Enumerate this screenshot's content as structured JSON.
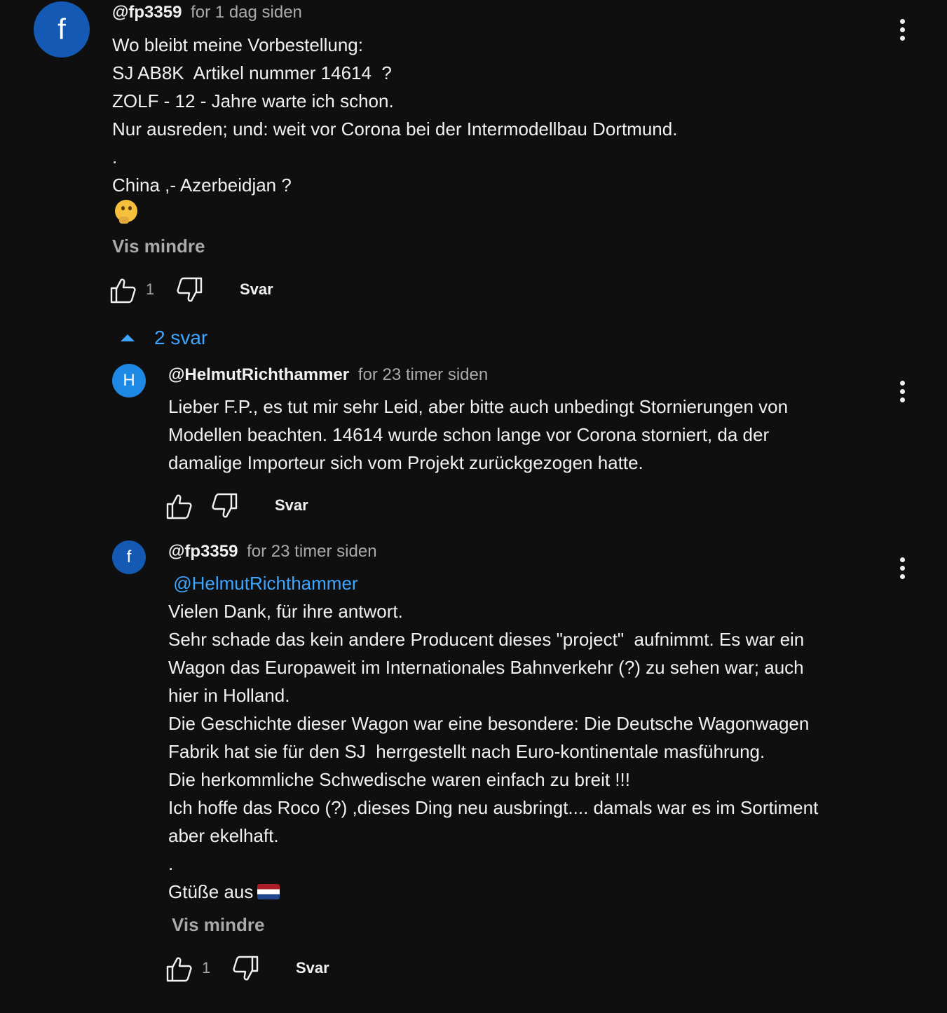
{
  "top_comment": {
    "avatar_letter": "f",
    "handle": "@fp3359",
    "time": "for 1 dag siden",
    "lines": [
      "Wo bleibt meine Vorbestellung:",
      "SJ AB8K  Artikel nummer 14614  ?",
      "ZOLF - 12 - Jahre warte ich schon.",
      "Nur ausreden; und: weit vor Corona bei der Intermodellbau Dortmund.",
      ".",
      "China ,- Azerbeidjan ?"
    ],
    "emoji": "thinking-face",
    "show_less": "Vis mindre",
    "like_count": "1",
    "reply_label": "Svar"
  },
  "replies_toggle": {
    "label": "2 svar"
  },
  "reply_1": {
    "avatar_letter": "H",
    "handle": "@HelmutRichthammer",
    "time": "for 23 timer siden",
    "lines": [
      "Lieber F.P., es tut mir sehr Leid, aber bitte auch unbedingt Stornierungen von",
      "Modellen beachten. 14614 wurde schon lange vor Corona storniert, da der",
      "damalige Importeur sich vom Projekt zurückgezogen hatte."
    ],
    "reply_label": "Svar"
  },
  "reply_2": {
    "avatar_letter": "f",
    "handle": "@fp3359",
    "time": "for 23 timer siden",
    "mention": "@HelmutRichthammer",
    "lines": [
      "Vielen Dank, für ihre antwort.",
      "Sehr schade das kein andere Producent dieses \"project\"  aufnimmt. Es war ein",
      "Wagon das Europaweit im Internationales Bahnverkehr (?) zu sehen war; auch",
      "hier in Holland.",
      "Die Geschichte dieser Wagon war eine besondere: Die Deutsche Wagonwagen",
      "Fabrik hat sie für den SJ  herrgestellt nach Euro-kontinentale masführung.",
      "Die herkommliche Schwedische waren einfach zu breit !!!",
      "Ich hoffe das Roco (?) ,dieses Ding neu ausbringt.... damals war es im Sortiment",
      "aber ekelhaft.",
      "."
    ],
    "greeting": "Gtüße aus",
    "flag": "netherlands-flag",
    "show_less": "Vis mindre",
    "like_count": "1",
    "reply_label": "Svar"
  },
  "icons": {
    "like": "thumbs-up-icon",
    "dislike": "thumbs-down-icon",
    "more": "more-vert-icon",
    "collapse": "caret-up-icon"
  },
  "colors": {
    "background": "#0f0f0f",
    "text": "#f1f1f1",
    "secondary": "#aaaaaa",
    "link": "#3ea6ff",
    "avatar": "#1565c0"
  }
}
